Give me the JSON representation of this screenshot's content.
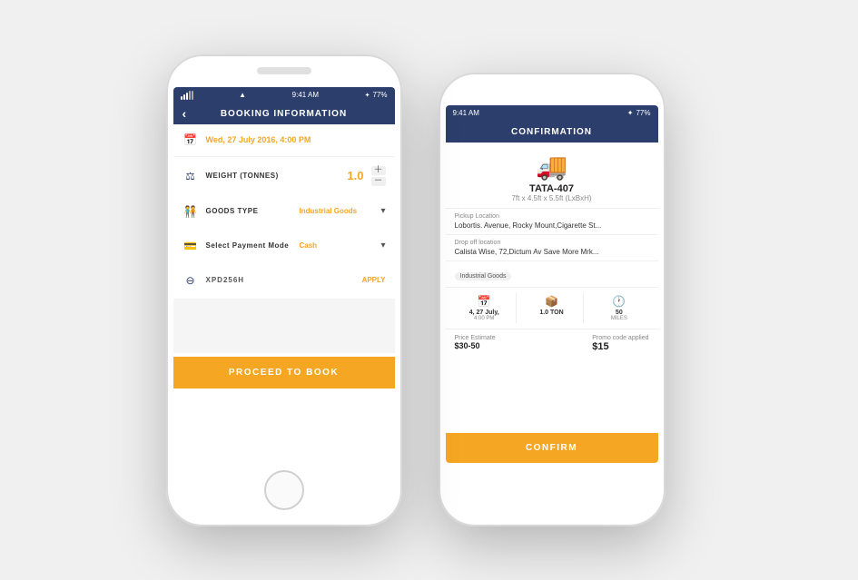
{
  "phone_front": {
    "status": {
      "signal": "●●●○○",
      "wifi": "wifi",
      "time": "9:41 AM",
      "bluetooth": "✦",
      "battery": "77%"
    },
    "header": {
      "back_label": "‹",
      "title": "BOOKING INFORMATION"
    },
    "rows": {
      "date_label": "Wed, 27 July 2016,  4:00 PM",
      "weight_label": "WEIGHT (TONNES)",
      "weight_value": "1.0",
      "goods_label": "GOODS TYPE",
      "goods_value": "Industrial Goods",
      "payment_label": "Select Payment Mode",
      "payment_value": "Cash",
      "promo_code": "XPD256H",
      "apply_label": "APPLY"
    },
    "proceed_btn": "PROCEED TO BOOK"
  },
  "phone_back": {
    "status": {
      "time": "9:41 AM",
      "bluetooth": "✦",
      "battery": "77%"
    },
    "header": {
      "title": "CONFIRMATION"
    },
    "truck": {
      "name": "TATA-407",
      "dimensions": "7ft x 4.5ft x 5.5ft (LxBxH)"
    },
    "pickup": {
      "label": "Pickup Location",
      "value": "Lobortis. Avenue, Rocky Mount,Cigarette St..."
    },
    "dropoff": {
      "label": "Drop off location",
      "value": "Calista Wise, 72,Dictum Av Save More Mrk..."
    },
    "goods_tag": "Industrial Goods",
    "stats": [
      {
        "icon": "📅",
        "val": "4, 27 July,",
        "val2": "4:00 PM"
      },
      {
        "icon": "📦",
        "val": "1.0 TON",
        "val2": ""
      },
      {
        "icon": "🕐",
        "val": "50",
        "val2": "MILES"
      }
    ],
    "price_estimate_label": "Price Estimate",
    "price_estimate_val": "$30-50",
    "promo_applied_label": "Promo code applied",
    "promo_val": "$15",
    "confirm_btn": "CONFIRM"
  }
}
